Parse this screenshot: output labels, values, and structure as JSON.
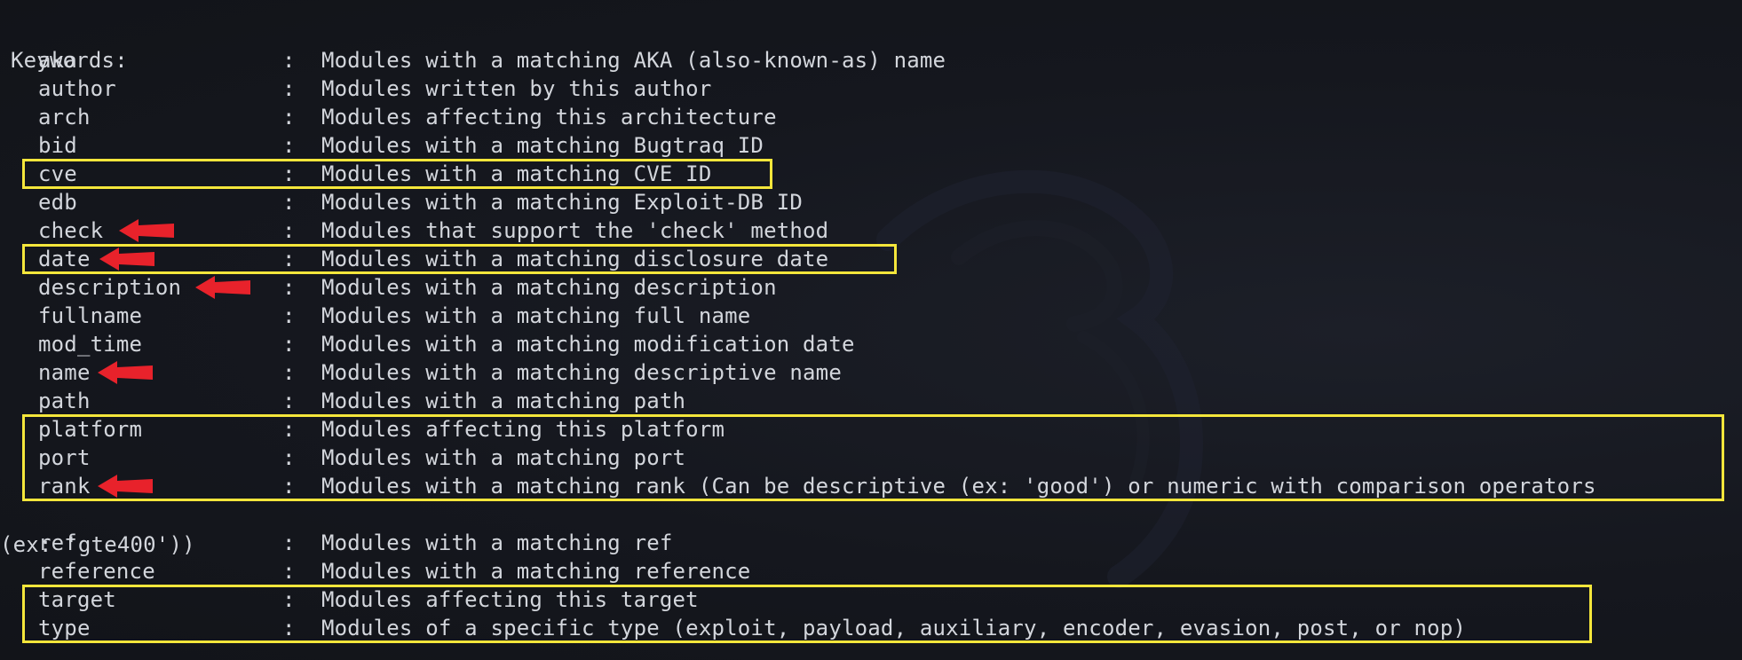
{
  "terminal": {
    "header": "Keywords:",
    "separator": ":",
    "keywords": [
      {
        "keyword": "aka",
        "description": "Modules with a matching AKA (also-known-as) name"
      },
      {
        "keyword": "author",
        "description": "Modules written by this author"
      },
      {
        "keyword": "arch",
        "description": "Modules affecting this architecture"
      },
      {
        "keyword": "bid",
        "description": "Modules with a matching Bugtraq ID"
      },
      {
        "keyword": "cve",
        "description": "Modules with a matching CVE ID"
      },
      {
        "keyword": "edb",
        "description": "Modules with a matching Exploit-DB ID"
      },
      {
        "keyword": "check",
        "description": "Modules that support the 'check' method"
      },
      {
        "keyword": "date",
        "description": "Modules with a matching disclosure date"
      },
      {
        "keyword": "description",
        "description": "Modules with a matching description"
      },
      {
        "keyword": "fullname",
        "description": "Modules with a matching full name"
      },
      {
        "keyword": "mod_time",
        "description": "Modules with a matching modification date"
      },
      {
        "keyword": "name",
        "description": "Modules with a matching descriptive name"
      },
      {
        "keyword": "path",
        "description": "Modules with a matching path"
      },
      {
        "keyword": "platform",
        "description": "Modules affecting this platform"
      },
      {
        "keyword": "port",
        "description": "Modules with a matching port"
      },
      {
        "keyword": "rank",
        "description": "Modules with a matching rank (Can be descriptive (ex: 'good') or numeric with comparison operators"
      },
      {
        "keyword": "ref",
        "description": "Modules with a matching ref"
      },
      {
        "keyword": "reference",
        "description": "Modules with a matching reference"
      },
      {
        "keyword": "target",
        "description": "Modules affecting this target"
      },
      {
        "keyword": "type",
        "description": "Modules of a specific type (exploit, payload, auxiliary, encoder, evasion, post, or nop)"
      }
    ],
    "rank_continuation": "(ex: 'gte400'))"
  },
  "annotations": {
    "highlight_color": "#f4e63b",
    "arrow_color": "#e8222b",
    "highlighted_keywords": [
      "cve",
      "date",
      "platform",
      "port",
      "rank",
      "target",
      "type"
    ],
    "arrowed_keywords": [
      "check",
      "date",
      "description",
      "name",
      "rank"
    ]
  },
  "background": {
    "color": "#14161d",
    "watermark": "kali-dragon-icon"
  }
}
